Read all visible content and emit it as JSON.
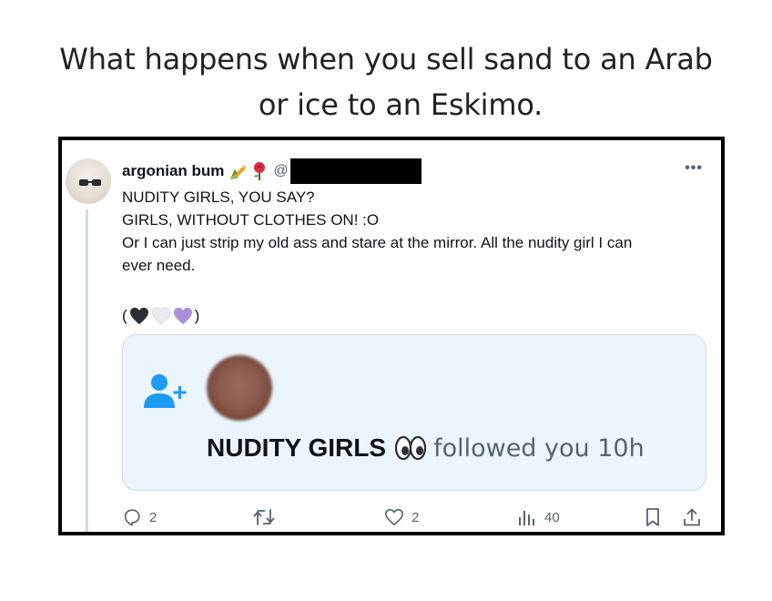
{
  "caption": {
    "line1": "What happens when you sell sand to an Arab",
    "line2": "or ice to an Eskimo."
  },
  "tweet": {
    "display_name": "argonian bum",
    "name_emojis": [
      "corn-emoji",
      "rose-emoji"
    ],
    "handle_prefix": "@",
    "handle_redacted": true,
    "more_label": "•••",
    "text_lines": [
      "NUDITY GIRLS, YOU SAY?",
      "GIRLS, WITHOUT CLOTHES ON! :O",
      "Or I can just strip my old ass and stare at the mirror. All the nudity girl I can",
      "ever need."
    ],
    "hearts_open": "(",
    "hearts_close": ")",
    "hearts": [
      {
        "name": "black-heart-icon",
        "color": "#292f33"
      },
      {
        "name": "white-heart-icon",
        "color": "#e9ecef"
      },
      {
        "name": "purple-heart-icon",
        "color": "#aa8ed6"
      }
    ]
  },
  "embedded_notification": {
    "icon": "follow-user-icon",
    "icon_color": "#1d9bf0",
    "background": "#eaf5fe",
    "follower_name": "NUDITY GIRLS",
    "follower_emoji": "eyes-emoji",
    "message": "followed you 10h"
  },
  "actions": {
    "reply_count": "2",
    "retweet_count": "",
    "like_count": "2",
    "views_count": "40"
  },
  "colors": {
    "text_primary": "#0f1419",
    "text_secondary": "#536471",
    "accent": "#1d9bf0",
    "frame_border": "#000000"
  }
}
